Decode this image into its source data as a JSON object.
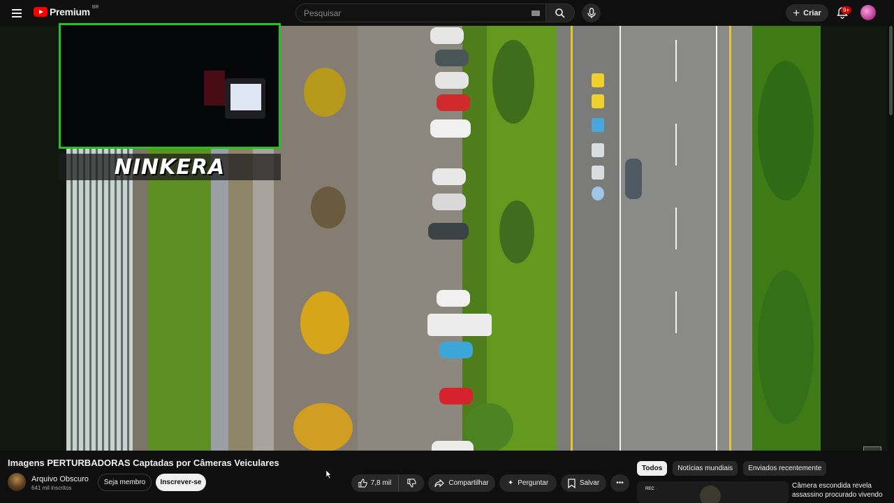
{
  "header": {
    "logo_text": "Premium",
    "country_code": "BR",
    "search_placeholder": "Pesquisar",
    "create_label": "Criar",
    "notification_badge": "9+"
  },
  "player": {
    "streamer_name": "NINKERA"
  },
  "video": {
    "title": "Imagens PERTURBADORAS Captadas por Câmeras Veiculares",
    "channel_name": "Arquivo Obscuro",
    "subscribers": "641 mil inscritos",
    "member_label": "Seja membro",
    "subscribe_label": "Inscrever-se",
    "likes": "7,8 mil",
    "share_label": "Compartilhar",
    "ask_label": "Perguntar",
    "save_label": "Salvar"
  },
  "sidebar": {
    "chips": [
      "Todos",
      "Notícias mundiais",
      "Enviados recentemente"
    ],
    "recommendation": {
      "thumb_label": "REC",
      "title": "Câmera escondida revela assassino procurado vivendo"
    }
  },
  "colors": {
    "accent": "#ff0000",
    "overlay_border": "#1ec51e",
    "background": "#0f0f0f"
  }
}
